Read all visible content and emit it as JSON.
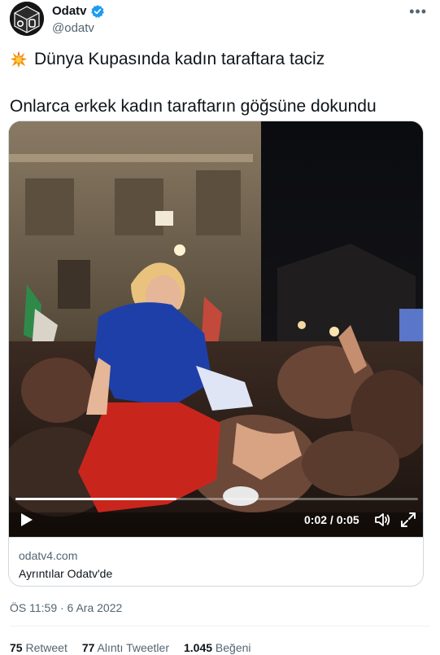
{
  "author": {
    "display_name": "Odatv",
    "handle": "@odatv",
    "verified": true,
    "avatar_text": "odtv"
  },
  "menu": {
    "more_label": "•••"
  },
  "tweet": {
    "line1": "Dünya Kupasında kadın taraftara taciz",
    "line1_emoji": "collision-icon",
    "line2": "Onlarca erkek kadın taraftarın göğsüne dokundu"
  },
  "video": {
    "time": "0:02 / 0:05",
    "progress": 0.4,
    "play_icon": "play-icon",
    "volume_icon": "volume-icon",
    "fullscreen_icon": "fullscreen-icon"
  },
  "link_card": {
    "domain": "odatv4.com",
    "title": "Ayrıntılar Odatv'de"
  },
  "timestamp": "ÖS 11:59 · 6 Ara 2022",
  "stats": {
    "retweets": {
      "count": "75",
      "label": "Retweet"
    },
    "quotes": {
      "count": "77",
      "label": "Alıntı Tweetler"
    },
    "likes": {
      "count": "1.045",
      "label": "Beğeni"
    }
  },
  "colors": {
    "verified_blue": "#1d9bf0",
    "secondary_text": "#536471",
    "border": "#cfd9de"
  }
}
